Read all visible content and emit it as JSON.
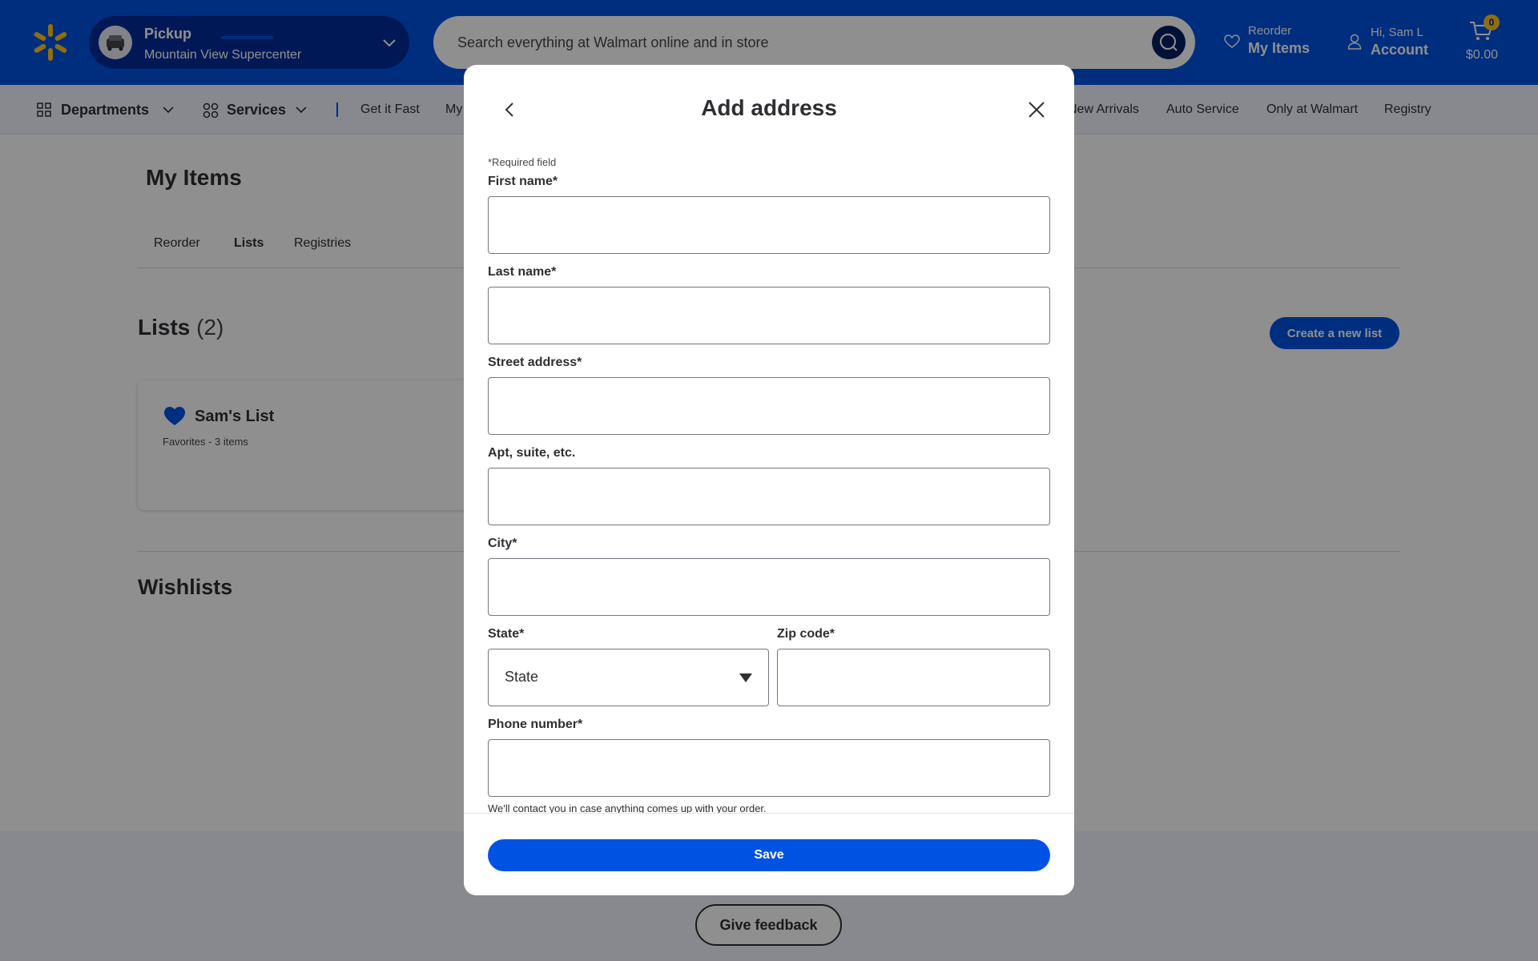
{
  "header": {
    "pickup_title": "Pickup",
    "pickup_store": "Mountain View Supercenter",
    "search_placeholder": "Search everything at Walmart online and in store",
    "reorder_small": "Reorder",
    "reorder_big": "My Items",
    "account_small": "Hi, Sam L",
    "account_big": "Account",
    "cart_count": "0",
    "cart_total": "$0.00",
    "brand_color": "#0053e2",
    "spark_color": "#ffc220"
  },
  "nav": {
    "departments": "Departments",
    "services": "Services",
    "get_it_fast": "Get it Fast",
    "my_items_partial": "My",
    "new_arrivals": "New Arrivals",
    "auto_service": "Auto Service",
    "only_at_walmart": "Only at Walmart",
    "registry": "Registry"
  },
  "page": {
    "title": "My Items",
    "tabs": [
      {
        "label": "Reorder"
      },
      {
        "label": "Lists"
      },
      {
        "label": "Registries"
      }
    ],
    "lists_heading": "Lists",
    "lists_count": "(2)",
    "create_list_label": "Create a new list",
    "list_card": {
      "name": "Sam's List",
      "meta": "Favorites - 3 items"
    },
    "wishlists_heading": "Wishlists",
    "feedback_label": "Give feedback"
  },
  "modal": {
    "title": "Add address",
    "required_note": "*Required field",
    "fields": {
      "first_name": "First name*",
      "last_name": "Last name*",
      "street": "Street address*",
      "apt": "Apt, suite, etc.",
      "city": "City*",
      "state": "State*",
      "state_value": "State",
      "zip": "Zip code*",
      "phone": "Phone number*"
    },
    "helper": "We'll contact you in case anything comes up with your order.",
    "save_label": "Save"
  }
}
